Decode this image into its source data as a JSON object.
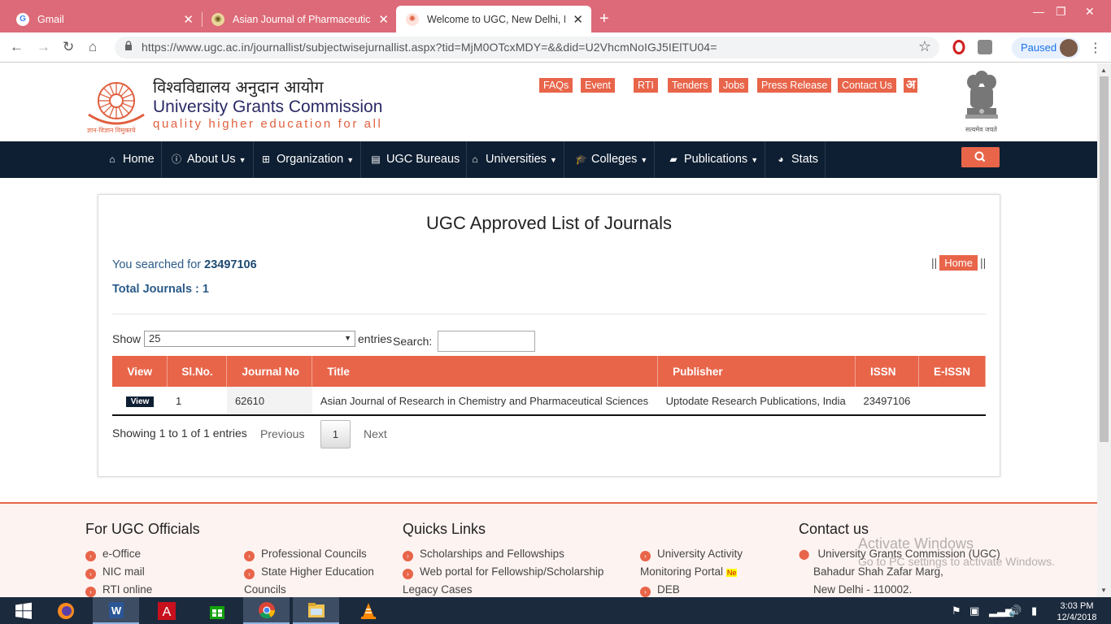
{
  "browser": {
    "tabs": [
      {
        "title": "Gmail",
        "active": false
      },
      {
        "title": "Asian Journal of Pharmaceutical a",
        "active": false
      },
      {
        "title": "Welcome to UGC, New Delhi, Ind",
        "active": true
      }
    ],
    "url": "https://www.ugc.ac.in/journallist/subjectwisejurnallist.aspx?tid=MjM0OTcxMDY=&&did=U2VhcmNoIGJ5IElTU04=",
    "profile_status": "Paused"
  },
  "header": {
    "brand_hindi": "विश्वविद्यालय अनुदान आयोग",
    "brand_english": "University Grants Commission",
    "tagline": "quality higher education for all",
    "logo_caption": "ज्ञान-विज्ञान विमुक्तये",
    "emblem_caption": "सत्यमेव जयते",
    "top_links": [
      "FAQs",
      "Event",
      "RTI",
      "Tenders",
      "Jobs",
      "Press Release",
      "Contact Us",
      "अ"
    ]
  },
  "nav": {
    "items": [
      "Home",
      "About Us",
      "Organization",
      "UGC Bureaus",
      "Universities",
      "Colleges",
      "Publications",
      "Stats"
    ]
  },
  "main": {
    "title": "UGC Approved List of Journals",
    "searched_prefix": "You searched for",
    "searched_value": "23497106",
    "total": "Total Journals : 1",
    "breadcrumb_home": "Home",
    "show_label": "Show",
    "page_size": "25",
    "entries_label": "entries",
    "search_label": "Search:",
    "search_value": "",
    "table": {
      "headers": [
        "View",
        "Sl.No.",
        "Journal No",
        "Title",
        "Publisher",
        "ISSN",
        "E-ISSN"
      ],
      "rows": [
        {
          "view": "View",
          "sl": "1",
          "journal_no": "62610",
          "title": "Asian Journal of Research in Chemistry and Pharmaceutical Sciences",
          "publisher": "Uptodate Research Publications, India",
          "issn": "23497106",
          "eissn": ""
        }
      ]
    },
    "showing": "Showing 1 to 1 of 1 entries",
    "pagination": {
      "previous": "Previous",
      "current": "1",
      "next": "Next"
    }
  },
  "footer": {
    "officials_heading": "For UGC Officials",
    "officials_col1": [
      "e-Office",
      "NIC mail",
      "RTI online"
    ],
    "officials_col2_a": "Professional Councils",
    "officials_col2_b1": "State Higher Education",
    "officials_col2_b2": "Councils",
    "quick_heading": "Quicks Links",
    "quick_a": "Scholarships and Fellowships",
    "quick_b1": "Web portal for Fellowship/Scholarship",
    "quick_b2": "Legacy Cases",
    "quick_c1": "University Activity",
    "quick_c2": "Monitoring Portal",
    "quick_c2_badge": "Ne",
    "quick_d": "DEB",
    "contact_heading": "Contact us",
    "contact_lines": [
      "University Grants Commission (UGC)",
      "Bahadur Shah Zafar Marg,",
      "New Delhi - 110002."
    ],
    "watermark_title": "Activate Windows",
    "watermark_sub": "Go to PC settings to activate Windows."
  },
  "taskbar": {
    "time": "3:03 PM",
    "date": "12/4/2018"
  },
  "colors": {
    "accent": "#e8654a",
    "navbar": "#0e1f33",
    "tabstrip": "#dd6a78",
    "link_blue": "#2c5b89"
  }
}
